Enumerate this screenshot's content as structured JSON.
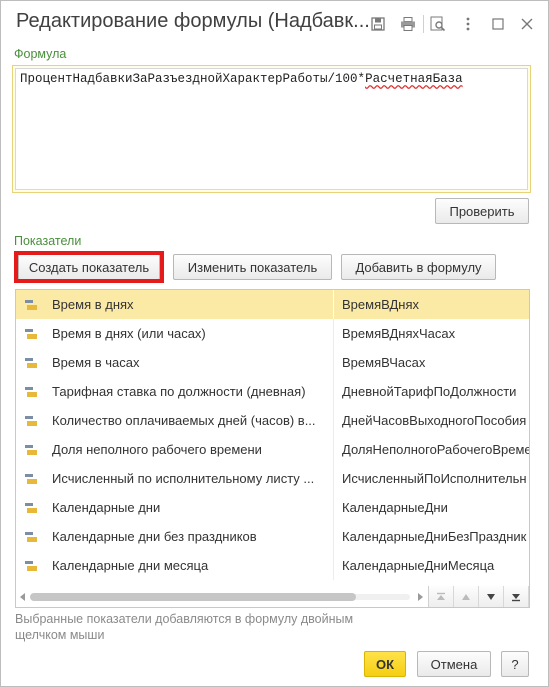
{
  "window": {
    "title": "Редактирование формулы (Надбавк...",
    "icons": [
      "save-icon",
      "print-icon",
      "preview-icon",
      "more-icon",
      "maximize-icon",
      "close-icon"
    ]
  },
  "formula": {
    "label": "Формула",
    "text_plain": "ПроцентНадбавкиЗаРазъезднойХарактерРаботы/100*",
    "text_error": "РасчетнаяБаза"
  },
  "check_button": "Проверить",
  "indicators": {
    "label": "Показатели",
    "create_button": "Создать показатель",
    "edit_button": "Изменить показатель",
    "add_button": "Добавить в формулу",
    "rows": [
      {
        "name": "Время в днях",
        "id": "ВремяВДнях",
        "selected": true
      },
      {
        "name": "Время в днях (или часах)",
        "id": "ВремяВДняхЧасах"
      },
      {
        "name": "Время в часах",
        "id": "ВремяВЧасах"
      },
      {
        "name": "Тарифная ставка по должности (дневная)",
        "id": "ДневнойТарифПоДолжности"
      },
      {
        "name": "Количество оплачиваемых дней (часов) в...",
        "id": "ДнейЧасовВыходногоПособия"
      },
      {
        "name": "Доля неполного рабочего времени",
        "id": "ДоляНеполногоРабочегоВремен"
      },
      {
        "name": "Исчисленный по исполнительному листу ...",
        "id": "ИсчисленныйПоИсполнительн"
      },
      {
        "name": "Календарные дни",
        "id": "КалендарныеДни"
      },
      {
        "name": "Календарные дни без праздников",
        "id": "КалендарныеДниБезПраздник"
      },
      {
        "name": "Календарные дни месяца",
        "id": "КалендарныеДниМесяца"
      }
    ]
  },
  "hint": "Выбранные показатели добавляются в формулу двойным щелчком мыши",
  "footer": {
    "ok": "ОК",
    "cancel": "Отмена",
    "help": "?"
  },
  "colors": {
    "accent_green": "#4a8f3c",
    "selection": "#fbe9a6",
    "highlight_red": "#e51b1b",
    "ok_yellow": "#f5cf12"
  }
}
